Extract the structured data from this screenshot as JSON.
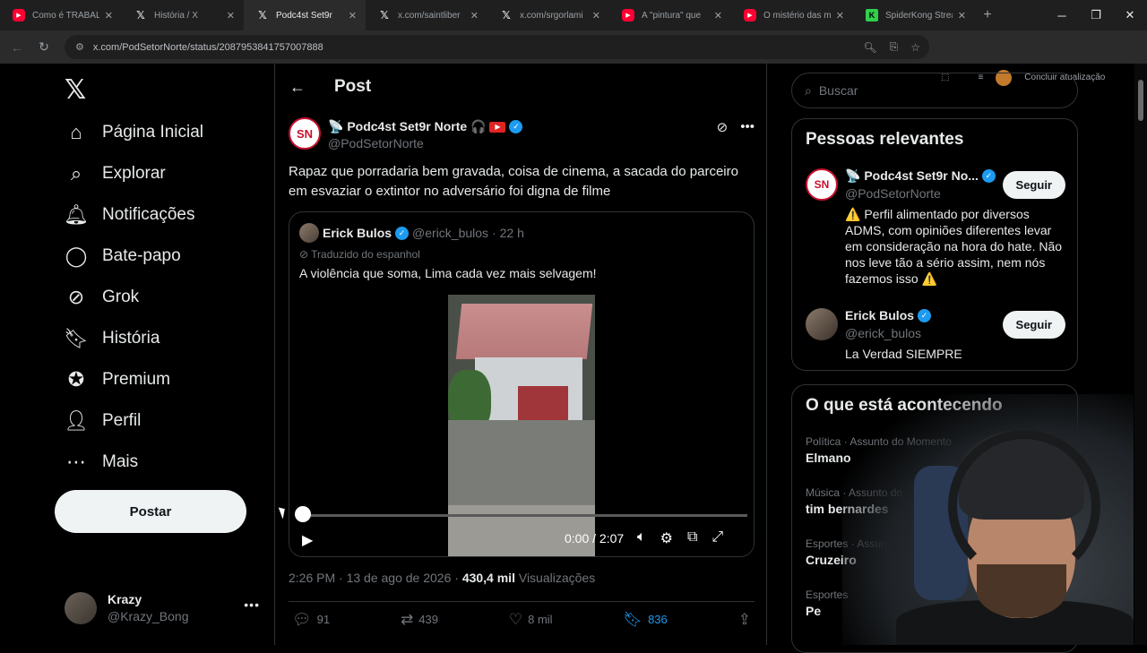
{
  "browser": {
    "tabs": [
      {
        "title": "Como é TRABAL",
        "fav": "yt"
      },
      {
        "title": "História / X",
        "fav": "x"
      },
      {
        "title": "Podc4st Set9r",
        "fav": "x",
        "active": true
      },
      {
        "title": "x.com/saintliber",
        "fav": "x"
      },
      {
        "title": "x.com/srgorlami",
        "fav": "x"
      },
      {
        "title": "A \"pintura\" que",
        "fav": "yt"
      },
      {
        "title": "O mistério das m",
        "fav": "yt"
      },
      {
        "title": "SpiderKong Strea",
        "fav": "k"
      }
    ],
    "url": "x.com/PodSetorNorte/status/2087953841757007888",
    "update_label": "Concluir atualização"
  },
  "nav": {
    "items": [
      {
        "label": "Página Inicial",
        "icon": "home-icon"
      },
      {
        "label": "Explorar",
        "icon": "search-icon"
      },
      {
        "label": "Notificações",
        "icon": "bell-icon"
      },
      {
        "label": "Bate-papo",
        "icon": "chat-icon"
      },
      {
        "label": "Grok",
        "icon": "grok-icon"
      },
      {
        "label": "História",
        "icon": "bookmark-icon"
      },
      {
        "label": "Premium",
        "icon": "verified-icon"
      },
      {
        "label": "Perfil",
        "icon": "person-icon"
      },
      {
        "label": "Mais",
        "icon": "more-icon"
      }
    ],
    "post_button": "Postar",
    "account": {
      "name": "Krazy",
      "handle": "@Krazy_Bong"
    }
  },
  "post": {
    "header": "Post",
    "author": {
      "name": "📡 Podc4st Set9r Norte 🎧",
      "handle": "@PodSetorNorte",
      "avatar_text": "SN"
    },
    "text": "Rapaz que porradaria bem gravada, coisa de cinema, a sacada do parceiro em esvaziar o extintor no adversário foi digna de filme",
    "quote": {
      "name": "Erick Bulos",
      "handle": "@erick_bulos",
      "time": "· 22 h",
      "translated": "Traduzido do espanhol",
      "text": "A violência que soma, Lima cada vez mais selvagem!",
      "video": {
        "time": "0:00 / 2:07",
        "progress": 0
      }
    },
    "date": "2:26 PM · 13 de ago de 2026 ·",
    "views": "430,4 mil",
    "views_label": "Visualizações",
    "stats": {
      "replies": "91",
      "reposts": "439",
      "likes": "8 mil",
      "bookmarks": "836"
    }
  },
  "right": {
    "search_placeholder": "Buscar",
    "relevant_title": "Pessoas relevantes",
    "people": [
      {
        "name": "📡 Podc4st Set9r No...",
        "handle": "@PodSetorNorte",
        "bio": "⚠️ Perfil alimentado por diversos ADMS, com opiniões diferentes levar em consideração na hora do hate. Não nos leve tão a sério assim, nem nós fazemos isso ⚠️",
        "button": "Seguir"
      },
      {
        "name": "Erick Bulos",
        "handle": "@erick_bulos",
        "bio": "La Verdad SIEMPRE",
        "button": "Seguir"
      }
    ],
    "trends_title": "O que está acontecendo",
    "trends": [
      {
        "context": "Política · Assunto do Momento",
        "name": "Elmano"
      },
      {
        "context": "Música · Assunto do",
        "name": "tim bernardes"
      },
      {
        "context": "Esportes · Assunto",
        "name": "Cruzeiro"
      },
      {
        "context": "Esportes",
        "name": "Pe"
      }
    ]
  },
  "colors": {
    "accent": "#1d9bf0",
    "background": "#000000",
    "border": "#2f3336"
  }
}
